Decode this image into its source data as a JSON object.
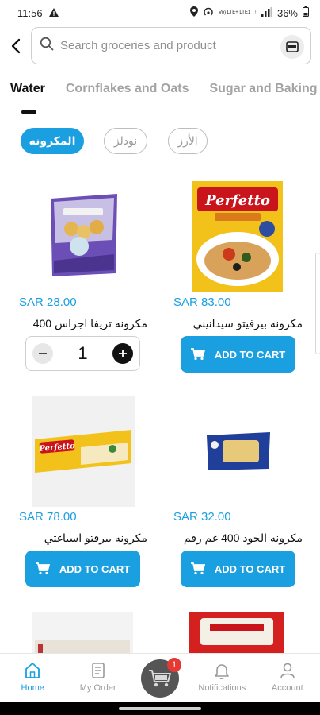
{
  "status_bar": {
    "time": "11:56",
    "network_label": "Vo) LTE+ LTE1 ↓↑",
    "battery": "36%"
  },
  "search": {
    "placeholder": "Search groceries and product"
  },
  "categories": [
    {
      "label": "Water",
      "active": true
    },
    {
      "label": "Cornflakes and Oats",
      "active": false
    },
    {
      "label": "Sugar and Baking",
      "active": false
    }
  ],
  "subcategories": [
    {
      "label": "المكرونه",
      "active": true
    },
    {
      "label": "نودلز",
      "active": false
    },
    {
      "label": "الأرز",
      "active": false
    }
  ],
  "products": [
    {
      "price": "SAR 28.00",
      "name": "مكرونه تريفا اجراس 400",
      "in_cart": true,
      "quantity": "1"
    },
    {
      "price": "SAR 83.00",
      "name": "مكرونه بيرفيتو سيدانيني",
      "in_cart": false,
      "button": "ADD TO CART"
    },
    {
      "price": "SAR 78.00",
      "name": "مكرونه بيرفتو اسباغتي",
      "in_cart": false,
      "button": "ADD TO CART"
    },
    {
      "price": "SAR 32.00",
      "name": "مكرونه الجود 400 غم رقم",
      "in_cart": false,
      "button": "ADD TO CART"
    }
  ],
  "bottom_nav": {
    "items": [
      {
        "label": "Home",
        "icon": "home-icon",
        "active": true
      },
      {
        "label": "My Order",
        "icon": "order-icon",
        "active": false
      },
      {
        "label": "Notifications",
        "icon": "bell-icon",
        "active": false
      },
      {
        "label": "Account",
        "icon": "person-icon",
        "active": false
      }
    ],
    "cart_badge": "1"
  },
  "colors": {
    "accent": "#1a9fe0",
    "badge": "#e53935"
  }
}
